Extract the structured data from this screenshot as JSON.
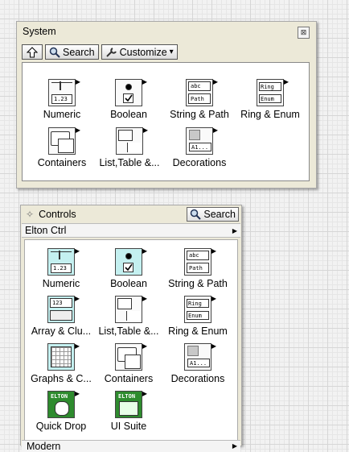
{
  "system_palette": {
    "title": "System",
    "close_glyph": "⊠",
    "toolbar": {
      "up_icon": "up-arrow-icon",
      "search_label": "Search",
      "customize_label": "Customize",
      "customize_arrow": "▾"
    },
    "items": [
      {
        "label": "Numeric",
        "icon": "numeric-icon",
        "text": "1.23"
      },
      {
        "label": "Boolean",
        "icon": "boolean-icon"
      },
      {
        "label": "String & Path",
        "icon": "string-path-icon",
        "text": "abc",
        "text2": "Path"
      },
      {
        "label": "Ring & Enum",
        "icon": "ring-enum-icon",
        "text": "Ring",
        "text2": "Enum"
      },
      {
        "label": "Containers",
        "icon": "containers-icon"
      },
      {
        "label": "List,Table &...",
        "icon": "list-table-icon"
      },
      {
        "label": "Decorations",
        "icon": "decorations-icon",
        "text": "A1..."
      }
    ]
  },
  "controls_palette": {
    "title": "Controls",
    "search_label": "Search",
    "category": "Elton Ctrl",
    "bottom_category": "Modern",
    "items": [
      {
        "label": "Numeric",
        "icon": "numeric-icon",
        "text": "1.23"
      },
      {
        "label": "Boolean",
        "icon": "boolean-icon"
      },
      {
        "label": "String & Path",
        "icon": "string-path-icon",
        "text": "abc",
        "text2": "Path"
      },
      {
        "label": "Array & Clu...",
        "icon": "array-cluster-icon",
        "text": "123"
      },
      {
        "label": "List,Table &...",
        "icon": "list-table-icon"
      },
      {
        "label": "Ring & Enum",
        "icon": "ring-enum-icon",
        "text": "Ring",
        "text2": "Enum"
      },
      {
        "label": "Graphs & C...",
        "icon": "graph-icon"
      },
      {
        "label": "Containers",
        "icon": "containers-icon"
      },
      {
        "label": "Decorations",
        "icon": "decorations-icon",
        "text": "A1..."
      },
      {
        "label": "Quick Drop",
        "icon": "quick-drop-icon",
        "text": "ELTON"
      },
      {
        "label": "UI Suite",
        "icon": "ui-suite-icon",
        "text": "ELTON"
      }
    ]
  },
  "colors": {
    "palette_bg": "#ece9d8",
    "cyan_highlight": "#c4f0f0",
    "elton_green": "#2e8b2e"
  }
}
